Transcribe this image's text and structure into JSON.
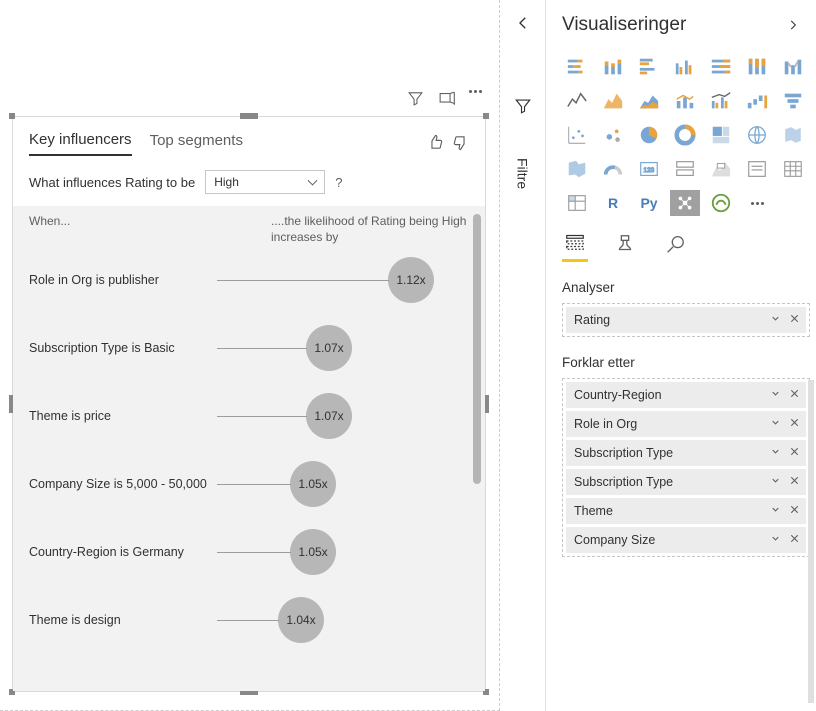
{
  "visual": {
    "tabs": {
      "key_influencers": "Key influencers",
      "top_segments": "Top segments"
    },
    "question_prefix": "What influences Rating to be",
    "dropdown_value": "High",
    "question_help": "?",
    "header_when": "When...",
    "header_increase": "....the likelihood of Rating being High increases by",
    "influencers": [
      {
        "label": "Role in Org is publisher",
        "value": "1.12x",
        "lineWidth": 172,
        "circleLeft": 360
      },
      {
        "label": "Subscription Type is Basic",
        "value": "1.07x",
        "lineWidth": 90,
        "circleLeft": 278
      },
      {
        "label": "Theme is price",
        "value": "1.07x",
        "lineWidth": 90,
        "circleLeft": 278
      },
      {
        "label": "Company Size is 5,000 - 50,000",
        "value": "1.05x",
        "lineWidth": 74,
        "circleLeft": 262
      },
      {
        "label": "Country-Region is Germany",
        "value": "1.05x",
        "lineWidth": 74,
        "circleLeft": 262
      },
      {
        "label": "Theme is design",
        "value": "1.04x",
        "lineWidth": 62,
        "circleLeft": 250
      }
    ]
  },
  "filters": {
    "label": "Filtre"
  },
  "vizpane": {
    "title": "Visualiseringer",
    "sections": {
      "analyze": "Analyser",
      "explain_by": "Forklar etter"
    },
    "analyze_fields": [
      {
        "label": "Rating"
      }
    ],
    "explain_fields": [
      {
        "label": "Country-Region"
      },
      {
        "label": "Role in Org"
      },
      {
        "label": "Subscription Type"
      },
      {
        "label": "Subscription Type"
      },
      {
        "label": "Theme"
      },
      {
        "label": "Company Size"
      }
    ],
    "r_label": "R",
    "py_label": "Py"
  }
}
